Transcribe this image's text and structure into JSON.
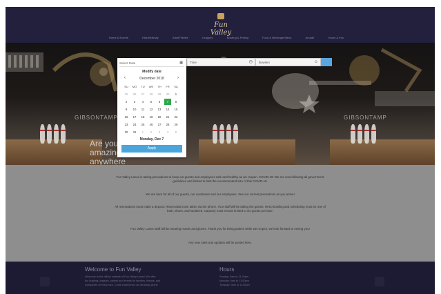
{
  "header": {
    "logo_text": "Fun Valley",
    "logo_icon": "bowling-pin-hat-icon",
    "nav": [
      "Home & Events",
      "Kids Birthday",
      "Adult Parties",
      "Leagues",
      "Bowling & Pricing",
      "Food & Beverage Menu",
      "Arcade",
      "Hours & Info"
    ]
  },
  "hero": {
    "brand_left": "GIBSONTAMP",
    "brand_right": "GIBSONTAMP",
    "lines": [
      "Are you",
      "amazing",
      "anywhere"
    ]
  },
  "booking": {
    "date_placeholder": "Select Date",
    "time_placeholder": "Time",
    "guests_placeholder": "Bowlers",
    "calendar_icon": "calendar-icon",
    "clock_icon": "clock-icon",
    "person_icon": "person-icon"
  },
  "calendar": {
    "title": "Modify date",
    "month": "December 2018",
    "weekdays": [
      "SU",
      "MO",
      "TU",
      "WE",
      "TH",
      "FR",
      "SA"
    ],
    "days": [
      "25",
      "26",
      "27",
      "28",
      "29",
      "30",
      "1",
      "2",
      "3",
      "4",
      "5",
      "6",
      "7",
      "8",
      "9",
      "10",
      "11",
      "12",
      "13",
      "14",
      "15",
      "16",
      "17",
      "18",
      "19",
      "20",
      "21",
      "22",
      "23",
      "24",
      "25",
      "26",
      "27",
      "28",
      "29",
      "30",
      "31",
      "1",
      "2",
      "3",
      "4",
      "5"
    ],
    "selected": "7",
    "footer": "Monday, Dec 7",
    "apply": "Apply",
    "selected_color": "#2ea84c",
    "accent_color": "#4aa5dc"
  },
  "content": {
    "paragraphs": [
      "Fun Valley Lanes is taking precautions to keep our guests and employees safe and healthy as we reopen. COVID-19: We are now following all government guidelines and limited to limit the recommended size of this COVID-19.",
      "We are here for all of our guests, our customers and our employees. See our current precautions as you arrive!",
      "All reservations must make a deposit. Reservations are taken via the phone. Your staff will be taking the guests. Retro bowling and scheduling must be one of both, shoes, and sanitized. Capacity must remain limited to six guests per lane.",
      "Fun Valley Lanes staff will be wearing masks and gloves. Thank you for being patient while we reopen, we look forward to seeing you!",
      "Any new rules and updates will be posted here."
    ]
  },
  "footer": {
    "welcome_title": "Welcome to Fun Valley",
    "welcome_text": [
      "Welcome to the official website of Fun Valley Lanes! We offer",
      "fun bowling, leagues, parties and events for families, friends, and",
      "companies of every size. Come experience our amazing lanes!"
    ],
    "hours_title": "Hours",
    "hours_text": [
      "Sunday: 9am to 11:00pm",
      "Monday: 9am to 11:00pm",
      "Tuesday: 9am to 11:00pm"
    ]
  }
}
